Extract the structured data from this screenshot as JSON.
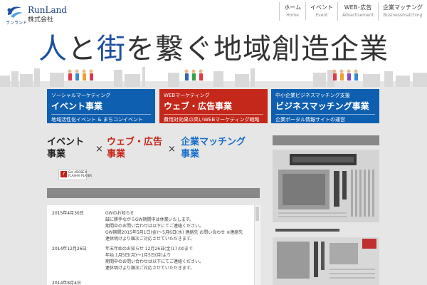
{
  "header": {
    "logo_name": "RunLand",
    "logo_sub": "株式会社",
    "logo_kana": "ランランド",
    "nav": [
      {
        "label": "ホーム",
        "sub": "Home"
      },
      {
        "label": "イベント",
        "sub": "Event"
      },
      {
        "label": "WEB･広告",
        "sub": "Advertisement"
      },
      {
        "label": "企業マッチング",
        "sub": "Businessmatching"
      }
    ]
  },
  "hero": {
    "title_accent": "人",
    "title_mid": "と",
    "title_accent2": "街",
    "title_rest": "を繋ぐ地域創造企業"
  },
  "banners": [
    {
      "category": "ソーシャルマーケティング",
      "title": "イベント事業",
      "desc": "地域活性化イベント & まちコンイベント"
    },
    {
      "category": "WEBマーケティング",
      "title": "ウェブ・広告事業",
      "desc": "費用対効果の高いWEBマーケティング戦略"
    },
    {
      "category": "中小企業ビジネスマッチング支援",
      "title": "ビジネスマッチング事業",
      "desc": "企業ポータル情報サイトの運営"
    }
  ],
  "services": [
    {
      "line1": "イベント",
      "line2": "事業",
      "color": "#222222"
    },
    {
      "line1": "ウェブ・広告",
      "line2": "事業",
      "color": "#c4281b"
    },
    {
      "line1": "企業マッチング",
      "line2": "事業",
      "color": "#1a6fc8"
    }
  ],
  "times_symbol": "×",
  "flash": {
    "icon": "f",
    "line1": "Get ADOBE®",
    "line2": "FLASH® PLAYER"
  },
  "news": [
    {
      "date": "2015年4月30日",
      "lines": [
        "GWのお知らせ",
        "誠に勝手ながらGW期間中は休業いたします。",
        "期間中のお問い合わせは以下にてご連絡ください。",
        "GW期間2015年5月1日(金)～5月6日(水) 連絡先 お問い合わせ ※連絡先",
        "連休明けより順次ご対応させていただきます。"
      ]
    },
    {
      "date": "2014年12月26日",
      "lines": [
        "年末年始のお知らせ 12月26日(金)17:00まで",
        "年始 1月5日(月)～1月5日(月)より",
        "期間中のお問い合わせは以下にてご連絡ください。",
        "連休明けより順次ご対応させていただきます。"
      ]
    },
    {
      "date": "2014年8月4日",
      "lines": []
    }
  ],
  "icons": {
    "logo": "runland-logo-icon",
    "flash": "flash-player-icon"
  },
  "colors": {
    "brand_blue": "#0f5fb0",
    "brand_red": "#c4281b",
    "background": "#e6e6e6"
  }
}
